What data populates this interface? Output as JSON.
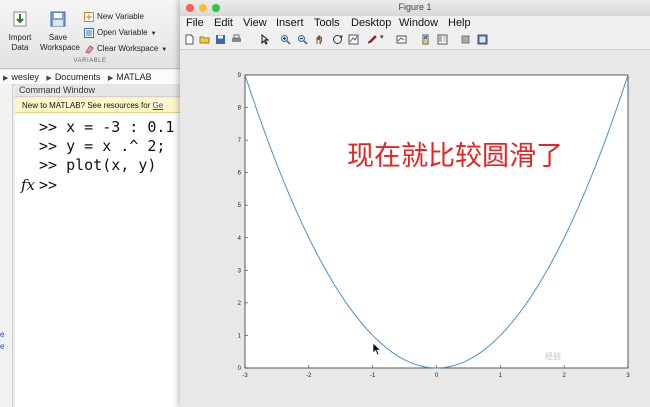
{
  "toolstrip": {
    "import_label_1": "Import",
    "import_label_2": "Data",
    "save_label_1": "Save",
    "save_label_2": "Workspace",
    "new_variable": "New Variable",
    "open_variable": "Open Variable",
    "clear_workspace": "Clear Workspace",
    "section_label": "VARIABLE"
  },
  "breadcrumb": {
    "items": [
      "wesley",
      "Documents",
      "MATLAB"
    ]
  },
  "command_window": {
    "title": "Command Window",
    "new_to_matlab_text": "New to MATLAB? See resources for ",
    "new_to_matlab_link": "Ge",
    "lines": [
      ">> x = -3 : 0.1",
      ">> y = x .^ 2;",
      ">> plot(x, y)"
    ],
    "fx_symbol": "fx",
    "prompt": ">>"
  },
  "figure": {
    "title": "Figure 1",
    "menus": [
      "File",
      "Edit",
      "View",
      "Insert",
      "Tools",
      "Desktop",
      "Window",
      "Help"
    ],
    "toolbar_icons": [
      "new-figure-icon",
      "open-icon",
      "save-icon",
      "print-icon",
      "pointer-icon",
      "zoom-in-icon",
      "zoom-out-icon",
      "pan-icon",
      "rotate-icon",
      "data-cursor-icon",
      "brush-icon",
      "link-icon",
      "colorbar-icon",
      "legend-icon",
      "hide-plot-tools-icon",
      "show-plot-tools-icon"
    ],
    "overlay_text": "现在就比较圆滑了",
    "watermark": "经验"
  },
  "chart_data": {
    "type": "line",
    "title": "",
    "xlabel": "",
    "ylabel": "",
    "xlim": [
      -3,
      3
    ],
    "ylim": [
      0,
      9
    ],
    "xticks": [
      -3,
      -2,
      -1,
      0,
      1,
      2,
      3
    ],
    "yticks": [
      0,
      1,
      2,
      3,
      4,
      5,
      6,
      7,
      8,
      9
    ],
    "grid": false,
    "series": [
      {
        "color": "#4a90c8",
        "x": [
          -3,
          -2.9,
          -2.8,
          -2.7,
          -2.6,
          -2.5,
          -2.4,
          -2.3,
          -2.2,
          -2.1,
          -2,
          -1.9,
          -1.8,
          -1.7,
          -1.6,
          -1.5,
          -1.4,
          -1.3,
          -1.2,
          -1.1,
          -1,
          -0.9,
          -0.8,
          -0.7,
          -0.6,
          -0.5,
          -0.4,
          -0.3,
          -0.2,
          -0.1,
          0,
          0.1,
          0.2,
          0.3,
          0.4,
          0.5,
          0.6,
          0.7,
          0.8,
          0.9,
          1,
          1.1,
          1.2,
          1.3,
          1.4,
          1.5,
          1.6,
          1.7,
          1.8,
          1.9,
          2,
          2.1,
          2.2,
          2.3,
          2.4,
          2.5,
          2.6,
          2.7,
          2.8,
          2.9,
          3
        ],
        "y": [
          9,
          8.41,
          7.84,
          7.29,
          6.76,
          6.25,
          5.76,
          5.29,
          4.84,
          4.41,
          4,
          3.61,
          3.24,
          2.89,
          2.56,
          2.25,
          1.96,
          1.69,
          1.44,
          1.21,
          1,
          0.81,
          0.64,
          0.49,
          0.36,
          0.25,
          0.16,
          0.09,
          0.04,
          0.01,
          0,
          0.01,
          0.04,
          0.09,
          0.16,
          0.25,
          0.36,
          0.49,
          0.64,
          0.81,
          1,
          1.21,
          1.44,
          1.69,
          1.96,
          2.25,
          2.56,
          2.89,
          3.24,
          3.61,
          4,
          4.41,
          4.84,
          5.29,
          5.76,
          6.25,
          6.76,
          7.29,
          7.84,
          8.41,
          9
        ]
      }
    ]
  }
}
